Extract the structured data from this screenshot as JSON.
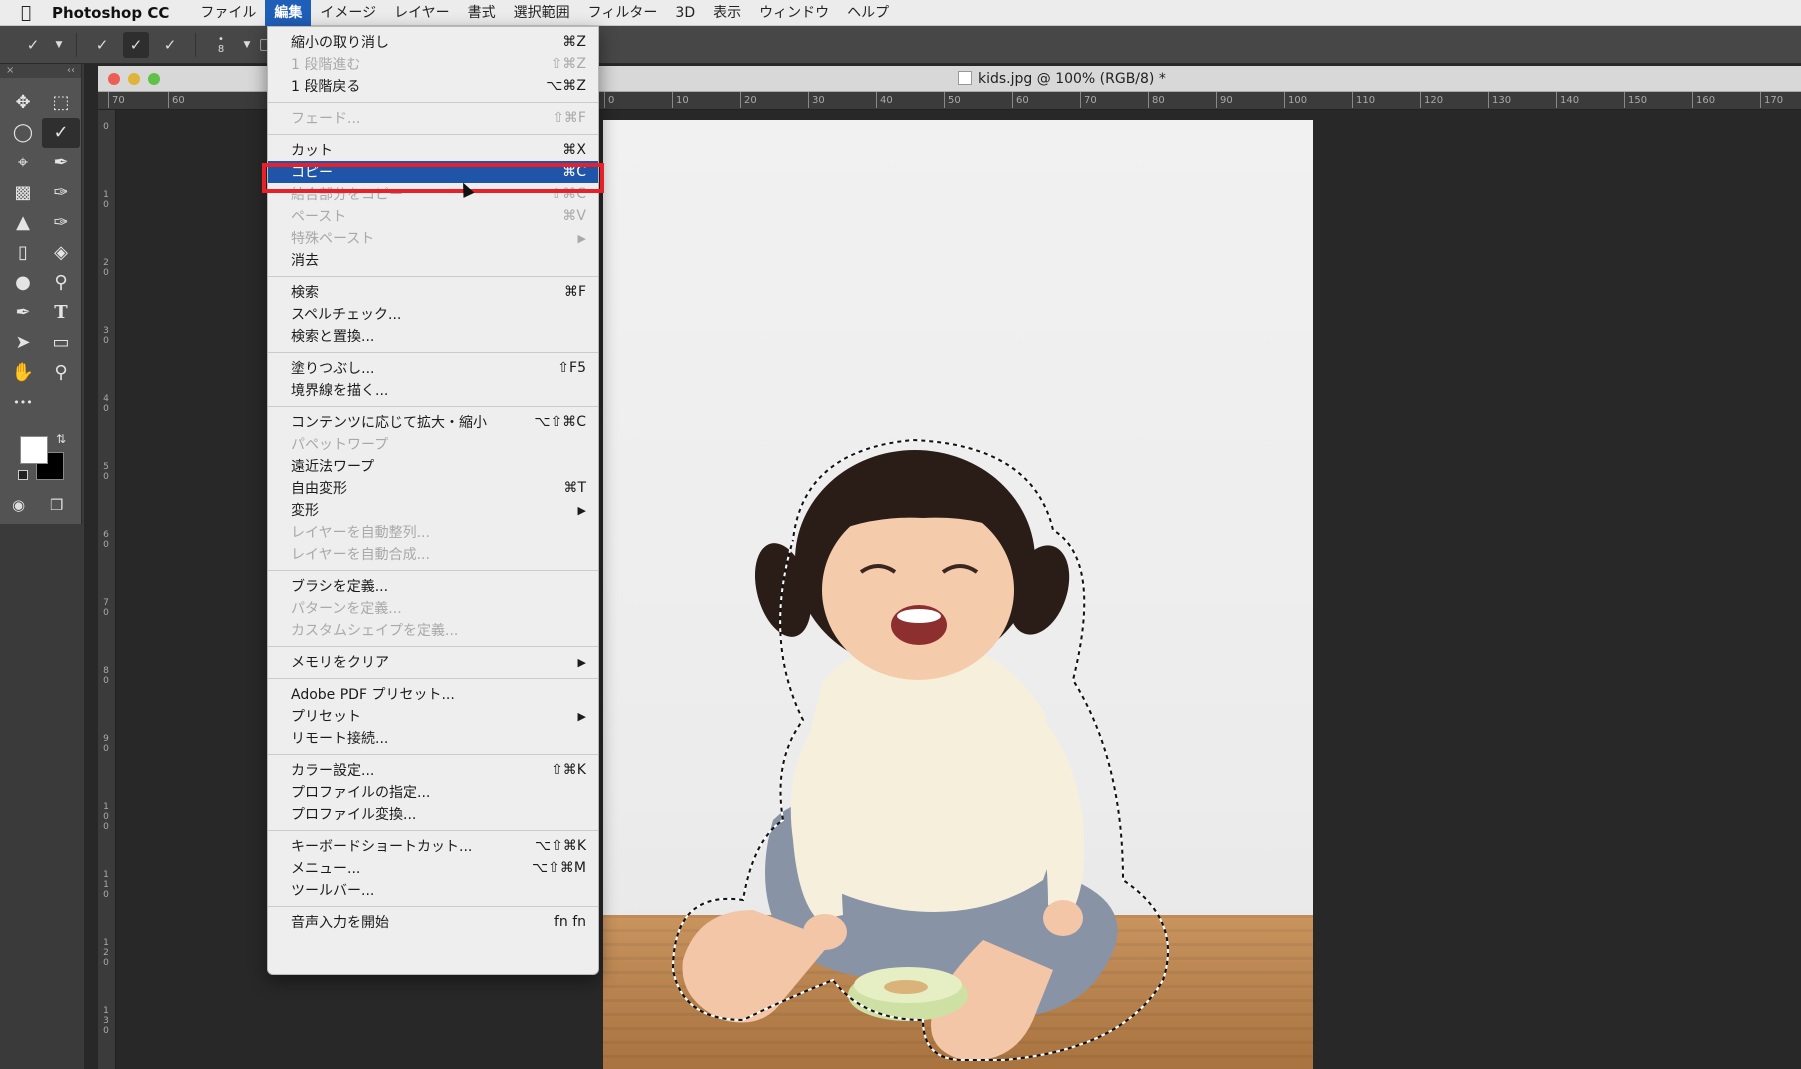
{
  "menubar": {
    "apple_icon": "apple-icon",
    "app_name": "Photoshop CC",
    "items": [
      "ファイル",
      "編集",
      "イメージ",
      "レイヤー",
      "書式",
      "選択範囲",
      "フィルター",
      "3D",
      "表示",
      "ウィンドウ",
      "ヘルプ"
    ],
    "active_index": 1
  },
  "options_bar": {
    "brush_size": "8",
    "icons": [
      "quick-selection-tool-icon",
      "new-selection-icon",
      "add-to-selection-icon",
      "subtract-from-selection-icon",
      "brush-picker-icon"
    ]
  },
  "tools": {
    "panel_close": "×",
    "panel_collapse": "‹‹",
    "items": [
      "move-tool-icon",
      "marquee-tool-icon",
      "lasso-tool-icon",
      "quick-selection-tool-icon",
      "crop-tool-icon",
      "eyedropper-tool-icon",
      "healing-brush-icon",
      "brush-tool-icon",
      "stamp-tool-icon",
      "history-brush-icon",
      "eraser-tool-icon",
      "paint-bucket-icon",
      "blur-tool-icon",
      "dodge-tool-icon",
      "pen-tool-icon",
      "type-tool-icon",
      "path-selection-icon",
      "rectangle-tool-icon",
      "hand-tool-icon",
      "zoom-tool-icon",
      "more-tools-icon"
    ],
    "type_glyph": "T",
    "more_glyph": "•••",
    "foreground_color": "#ffffff",
    "background_color": "#000000"
  },
  "document": {
    "title": "kids.jpg @ 100% (RGB/8) *",
    "ruler_h_left": [
      "70",
      "60"
    ],
    "ruler_h_right": [
      "0",
      "10",
      "20",
      "30",
      "40",
      "50",
      "60",
      "70",
      "80",
      "90",
      "100",
      "110",
      "120",
      "130",
      "140",
      "150",
      "160",
      "170"
    ],
    "ruler_v": [
      "0",
      "1 0",
      "2 0",
      "3 0",
      "4 0",
      "5 0",
      "6 0",
      "7 0",
      "8 0",
      "9 0",
      "1 0 0",
      "1 1 0",
      "1 2 0",
      "1 3 0"
    ]
  },
  "edit_menu": {
    "groups": [
      [
        {
          "label": "縮小の取り消し",
          "shortcut": "⌘Z",
          "disabled": false
        },
        {
          "label": "1 段階進む",
          "shortcut": "⇧⌘Z",
          "disabled": true
        },
        {
          "label": "1 段階戻る",
          "shortcut": "⌥⌘Z",
          "disabled": false
        }
      ],
      [
        {
          "label": "フェード...",
          "shortcut": "⇧⌘F",
          "disabled": true
        }
      ],
      [
        {
          "label": "カット",
          "shortcut": "⌘X",
          "disabled": false
        },
        {
          "label": "コピー",
          "shortcut": "⌘C",
          "disabled": false,
          "highlighted": true
        },
        {
          "label": "結合部分をコピー",
          "shortcut": "⇧⌘C",
          "disabled": true
        },
        {
          "label": "ペースト",
          "shortcut": "⌘V",
          "disabled": true
        },
        {
          "label": "特殊ペースト",
          "shortcut": "",
          "submenu": true,
          "disabled": true
        },
        {
          "label": "消去",
          "shortcut": "",
          "disabled": false
        }
      ],
      [
        {
          "label": "検索",
          "shortcut": "⌘F",
          "disabled": false
        },
        {
          "label": "スペルチェック...",
          "shortcut": "",
          "disabled": false
        },
        {
          "label": "検索と置換...",
          "shortcut": "",
          "disabled": false
        }
      ],
      [
        {
          "label": "塗りつぶし...",
          "shortcut": "⇧F5",
          "disabled": false
        },
        {
          "label": "境界線を描く...",
          "shortcut": "",
          "disabled": false
        }
      ],
      [
        {
          "label": "コンテンツに応じて拡大・縮小",
          "shortcut": "⌥⇧⌘C",
          "disabled": false
        },
        {
          "label": "パペットワープ",
          "shortcut": "",
          "disabled": true
        },
        {
          "label": "遠近法ワープ",
          "shortcut": "",
          "disabled": false
        },
        {
          "label": "自由変形",
          "shortcut": "⌘T",
          "disabled": false
        },
        {
          "label": "変形",
          "shortcut": "",
          "submenu": true,
          "disabled": false
        },
        {
          "label": "レイヤーを自動整列...",
          "shortcut": "",
          "disabled": true
        },
        {
          "label": "レイヤーを自動合成...",
          "shortcut": "",
          "disabled": true
        }
      ],
      [
        {
          "label": "ブラシを定義...",
          "shortcut": "",
          "disabled": false
        },
        {
          "label": "パターンを定義...",
          "shortcut": "",
          "disabled": true
        },
        {
          "label": "カスタムシェイプを定義...",
          "shortcut": "",
          "disabled": true
        }
      ],
      [
        {
          "label": "メモリをクリア",
          "shortcut": "",
          "submenu": true,
          "disabled": false
        }
      ],
      [
        {
          "label": "Adobe PDF プリセット...",
          "shortcut": "",
          "disabled": false
        },
        {
          "label": "プリセット",
          "shortcut": "",
          "submenu": true,
          "disabled": false
        },
        {
          "label": "リモート接続...",
          "shortcut": "",
          "disabled": false
        }
      ],
      [
        {
          "label": "カラー設定...",
          "shortcut": "⇧⌘K",
          "disabled": false
        },
        {
          "label": "プロファイルの指定...",
          "shortcut": "",
          "disabled": false
        },
        {
          "label": "プロファイル変換...",
          "shortcut": "",
          "disabled": false
        }
      ],
      [
        {
          "label": "キーボードショートカット...",
          "shortcut": "⌥⇧⌘K",
          "disabled": false
        },
        {
          "label": "メニュー...",
          "shortcut": "⌥⇧⌘M",
          "disabled": false
        },
        {
          "label": "ツールバー...",
          "shortcut": "",
          "disabled": false
        }
      ],
      [
        {
          "label": "音声入力を開始",
          "shortcut": "fn fn",
          "disabled": false
        }
      ]
    ],
    "submenu_arrow": "▶"
  },
  "colors": {
    "highlight": "#1f55a8",
    "callout": "#e8202a",
    "close_light": "#ec5f57",
    "min_light": "#e0b43a",
    "zoom_light": "#5fc14a"
  }
}
